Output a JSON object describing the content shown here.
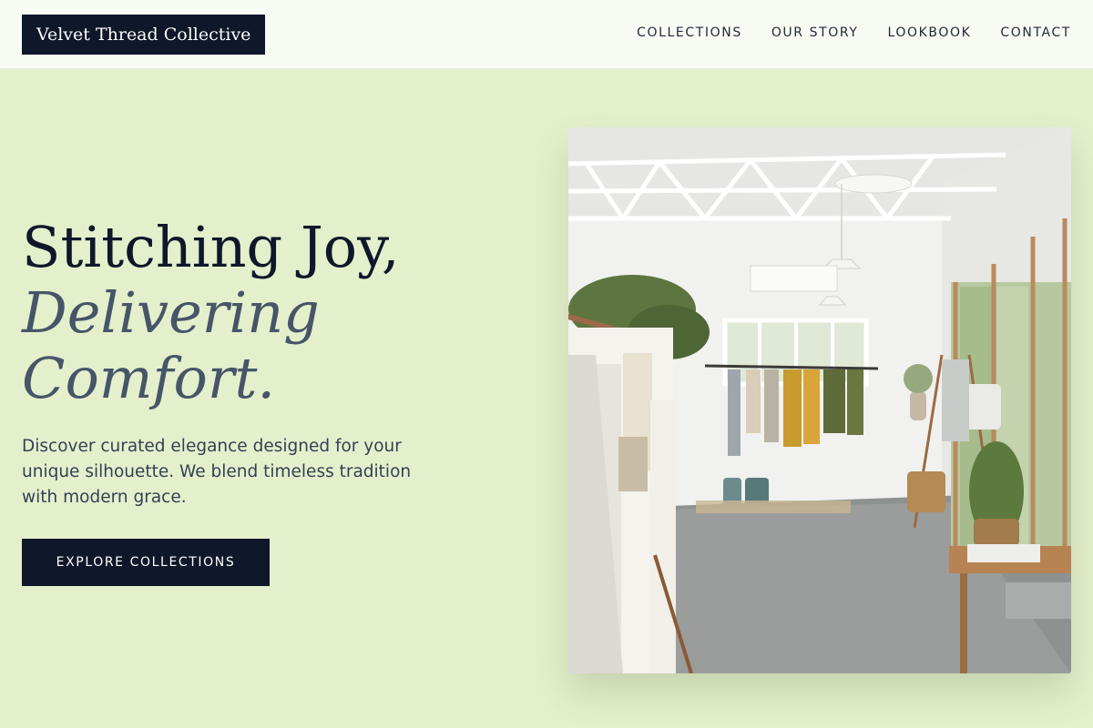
{
  "brand": {
    "name": "Velvet Thread Collective"
  },
  "nav": {
    "items": [
      {
        "label": "COLLECTIONS"
      },
      {
        "label": "OUR STORY"
      },
      {
        "label": "LOOKBOOK"
      },
      {
        "label": "CONTACT"
      }
    ]
  },
  "hero": {
    "headline_line1": "Stitching Joy,",
    "headline_line2": "Delivering",
    "headline_line3": "Comfort.",
    "description": "Discover curated elegance designed for your unique silhouette. We blend timeless tradition with modern grace.",
    "cta_label": "EXPLORE COLLECTIONS"
  },
  "colors": {
    "background": "#e4f0cc",
    "header_bg": "#f8fbf3",
    "primary": "#0f172a",
    "accent_text": "#475569"
  }
}
